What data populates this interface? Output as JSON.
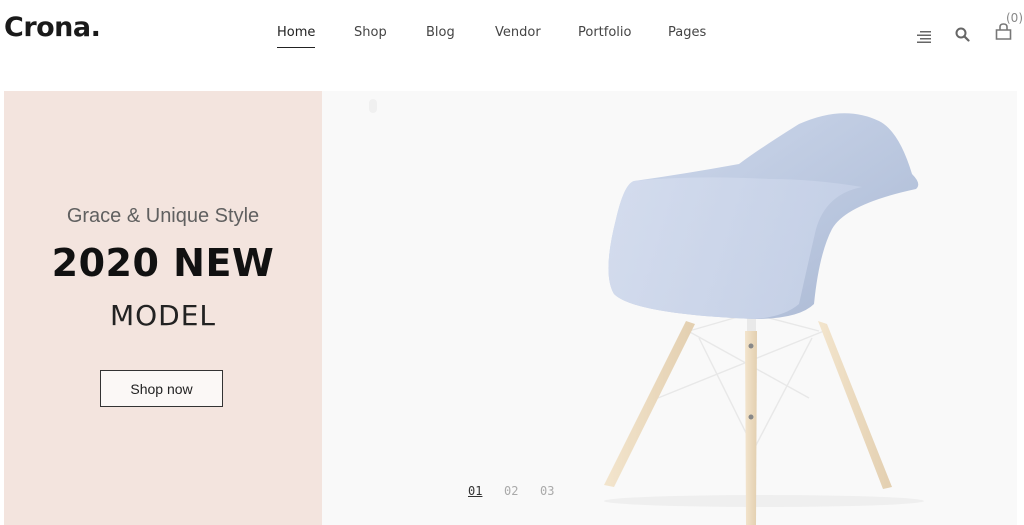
{
  "brand": {
    "logo": "Crona."
  },
  "nav": {
    "items": [
      {
        "label": "Home",
        "active": true
      },
      {
        "label": "Shop",
        "active": false
      },
      {
        "label": "Blog",
        "active": false
      },
      {
        "label": "Vendor",
        "active": false
      },
      {
        "label": "Portfolio",
        "active": false
      },
      {
        "label": "Pages",
        "active": false
      }
    ]
  },
  "header_icons": {
    "menu": "menu-lines-icon",
    "search": "search-icon",
    "cart": "shopping-bag-icon",
    "cart_count": "(0)"
  },
  "hero": {
    "subtitle": "Grace & Unique Style",
    "title_line1": "2020 NEW",
    "title_line2": "MODEL",
    "cta_label": "Shop now",
    "image": "blue-shell-armchair-wooden-legs",
    "colors": {
      "panel_bg": "#f3e4de",
      "image_bg": "#f9f9f9",
      "chair_shell": "#c4d0e6",
      "legs": "#ecd9bf"
    },
    "pagination": [
      {
        "label": "01",
        "active": true
      },
      {
        "label": "02",
        "active": false
      },
      {
        "label": "03",
        "active": false
      }
    ]
  }
}
